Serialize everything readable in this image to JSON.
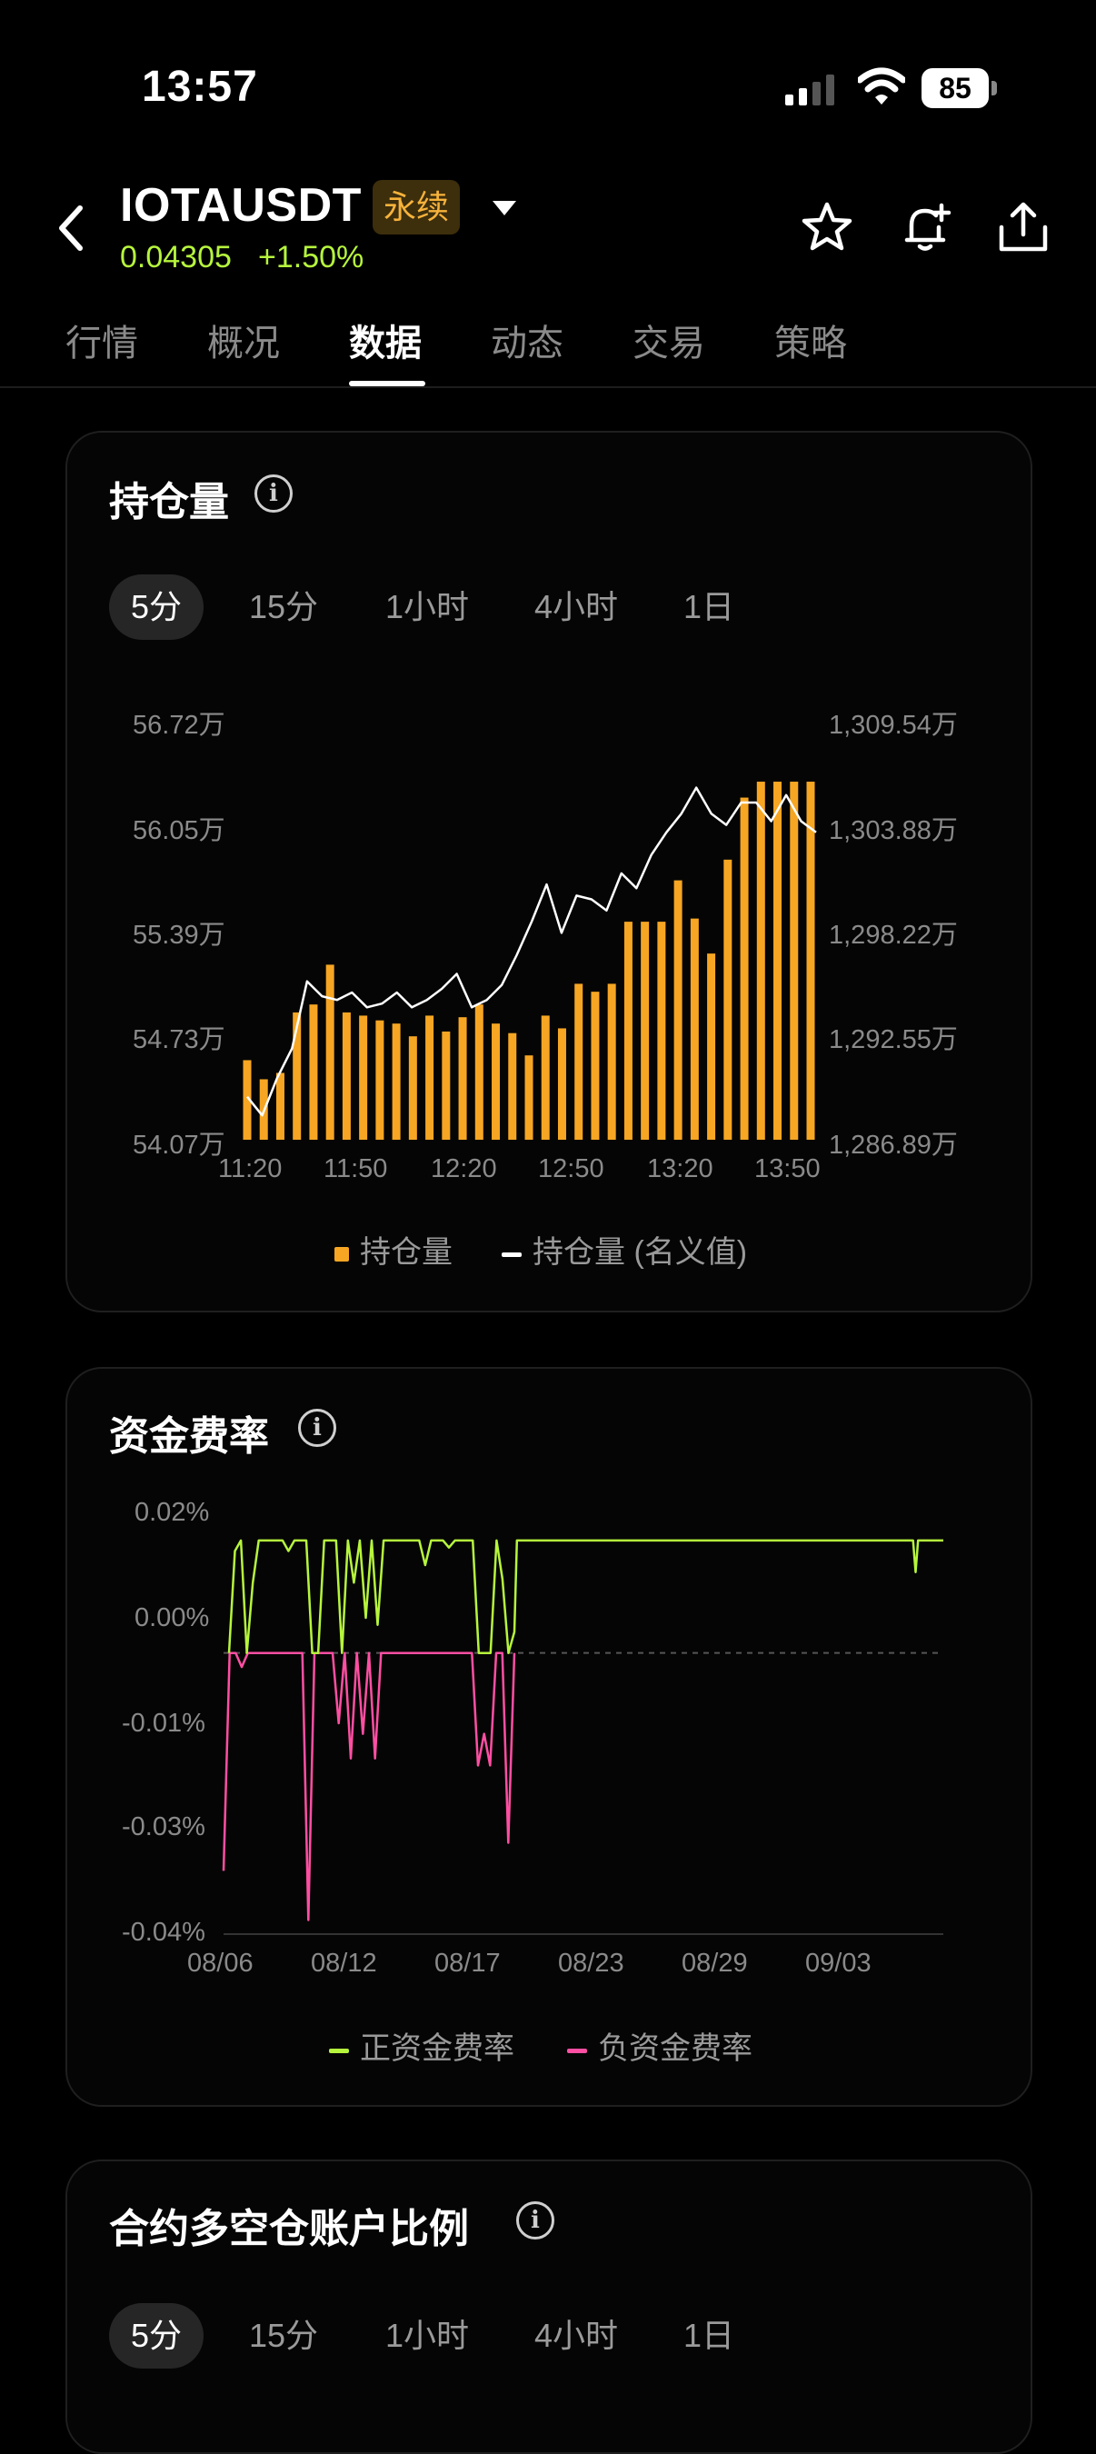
{
  "status": {
    "time": "13:57",
    "battery": "85"
  },
  "header": {
    "pair": "IOTAUSDT",
    "badge": "永续",
    "price": "0.04305",
    "change": "+1.50%",
    "up_color": "#b6f53d"
  },
  "tabs": [
    "行情",
    "概况",
    "数据",
    "动态",
    "交易",
    "策略"
  ],
  "active_tab": "数据",
  "open_interest": {
    "title": "持仓量",
    "periods": [
      "5分",
      "15分",
      "1小时",
      "4小时",
      "1日"
    ],
    "selected_period": "5分",
    "legend": [
      "持仓量",
      "持仓量 (名义值)"
    ]
  },
  "funding": {
    "title": "资金费率",
    "legend": [
      "正资金费率",
      "负资金费率"
    ]
  },
  "ratio": {
    "title": "合约多空仓账户比例",
    "periods": [
      "5分",
      "15分",
      "1小时",
      "4小时",
      "1日"
    ],
    "selected_period": "5分"
  },
  "chart_data": [
    {
      "type": "bar",
      "title": "持仓量",
      "y_left_ticks": [
        "56.72万",
        "56.05万",
        "55.39万",
        "54.73万",
        "54.07万"
      ],
      "y_right_ticks": [
        "1,309.54万",
        "1,303.88万",
        "1,298.22万",
        "1,292.55万",
        "1,286.89万"
      ],
      "x_ticks": [
        "11:20",
        "11:50",
        "12:20",
        "12:50",
        "13:20",
        "13:50"
      ],
      "ylim_left": [
        54.07,
        56.72
      ],
      "ylim_right": [
        1286.89,
        1309.54
      ],
      "series": [
        {
          "name": "持仓量",
          "color": "#f6a623",
          "type": "bar",
          "values": [
            54.57,
            54.45,
            54.49,
            54.87,
            54.92,
            55.17,
            54.87,
            54.85,
            54.82,
            54.8,
            54.72,
            54.85,
            54.75,
            54.84,
            54.92,
            54.8,
            54.74,
            54.6,
            54.85,
            54.77,
            55.05,
            55.0,
            55.05,
            55.44,
            55.44,
            55.44,
            55.7,
            55.46,
            55.24,
            55.83,
            56.22,
            56.32,
            56.32,
            56.32,
            56.32
          ]
        },
        {
          "name": "持仓量 (名义值)",
          "color": "#ffffff",
          "type": "line",
          "values": [
            1289.2,
            1288.2,
            1290.2,
            1291.8,
            1295.4,
            1294.6,
            1294.4,
            1294.8,
            1294.0,
            1294.2,
            1294.8,
            1294.0,
            1294.4,
            1295.0,
            1295.8,
            1294.0,
            1294.4,
            1295.2,
            1296.8,
            1298.6,
            1300.6,
            1298.0,
            1300.0,
            1299.8,
            1299.2,
            1301.2,
            1300.4,
            1302.2,
            1303.4,
            1304.4,
            1305.8,
            1304.4,
            1303.8,
            1305.0,
            1305.0,
            1304.0,
            1305.4,
            1304.0,
            1303.4
          ]
        }
      ]
    },
    {
      "type": "line",
      "title": "资金费率",
      "y_ticks": [
        "0.02%",
        "0.00%",
        "-0.01%",
        "-0.03%",
        "-0.04%"
      ],
      "x_ticks": [
        "08/06",
        "08/12",
        "08/17",
        "08/23",
        "08/29",
        "09/03"
      ],
      "ylim": [
        -0.04,
        0.02
      ],
      "series": [
        {
          "name": "正资金费率",
          "color": "#b6f53d",
          "values": [
            0,
            0.0145,
            0.016,
            0,
            0.01,
            0.016,
            0.016,
            0.016,
            0.016,
            0.016,
            0.0145,
            0.016,
            0.016,
            0.016,
            0,
            0,
            0.016,
            0.016,
            0.016,
            0,
            0.016,
            0.01,
            0.016,
            0.005,
            0.016,
            0.004,
            0.016,
            0.016,
            0.016,
            0.016,
            0.016,
            0.016,
            0.016,
            0.0125,
            0.016,
            0.016,
            0.016,
            0.015,
            0.016,
            0.016,
            0.016,
            0.016,
            0,
            0,
            0,
            0.016,
            0.0105,
            0,
            0.003,
            0.016,
            0.016,
            0.016,
            0.016,
            0.016,
            0.016,
            0.016,
            0.016,
            0.016,
            0.016,
            0.016,
            0.016,
            0.016,
            0.016,
            0.016,
            0.016,
            0.016,
            0.016,
            0.016,
            0.016,
            0.016,
            0.016,
            0.016,
            0.016,
            0.016,
            0.016,
            0.016,
            0.016,
            0.016,
            0.016,
            0.016,
            0.016,
            0.016,
            0.016,
            0.016,
            0.016,
            0.016,
            0.016,
            0.016,
            0.016,
            0.016,
            0.016,
            0.016,
            0.016,
            0.016,
            0.016,
            0.016,
            0.016,
            0.016,
            0.016,
            0.016,
            0.016,
            0.016,
            0.016,
            0.016,
            0.016,
            0.016,
            0.016,
            0.016,
            0.016,
            0.016,
            0.016,
            0.016,
            0.016,
            0.016,
            0.016,
            0.016,
            0.016,
            0.016,
            0.016,
            0.016,
            0.016,
            0.016,
            0.016,
            0.016,
            0.016,
            0.016,
            0.016,
            0.016,
            0.016,
            0.016,
            0.016,
            0.016,
            0.016,
            0.016,
            0.016,
            0.016,
            0.016,
            0.016,
            0.016,
            0.016,
            0.016,
            0.016,
            0.016,
            0.016,
            0.016,
            0.016,
            0.016,
            0.016,
            0.016,
            0.016,
            0.016,
            0.016,
            0.016,
            0.016,
            0.016,
            0.016,
            0.016,
            0.016,
            0.016,
            0.016,
            0.016,
            0.016,
            0.016,
            0.016,
            0.016,
            0.016,
            0.016,
            0.016,
            0.016,
            0.016,
            0.016,
            0.016,
            0.016,
            0.016,
            0.016,
            0.016,
            0.016,
            0.016,
            0.016,
            0.016,
            0.016,
            0.016,
            0.016,
            0.016,
            0.016,
            0.016,
            0.016,
            0.016,
            0.016,
            0.016,
            0.016,
            0.016,
            0.016,
            0.016,
            0.016,
            0.016,
            0.016,
            0.016,
            0.016,
            0.016,
            0.016,
            0.016,
            0.016,
            0.016,
            0.016,
            0.016,
            0.016,
            0.0115,
            0.016,
            0.016,
            0.016,
            0.016,
            0.016,
            0.016,
            0.016,
            0.016,
            0.016,
            0.016,
            0.016
          ]
        },
        {
          "name": "负资金费率",
          "color": "#ff4fa3",
          "values": [
            -0.031,
            0,
            0,
            -0.002,
            0,
            0,
            0,
            0,
            0,
            0,
            0,
            0,
            0,
            0,
            -0.038,
            0,
            0,
            0,
            0,
            -0.01,
            0,
            -0.015,
            0,
            -0.0115,
            0,
            -0.015,
            0,
            0,
            0,
            0,
            0,
            0,
            0,
            0,
            0,
            0,
            0,
            0,
            0,
            0,
            0,
            0,
            -0.016,
            -0.0115,
            -0.016,
            0,
            0,
            -0.027,
            0
          ]
        }
      ]
    }
  ]
}
